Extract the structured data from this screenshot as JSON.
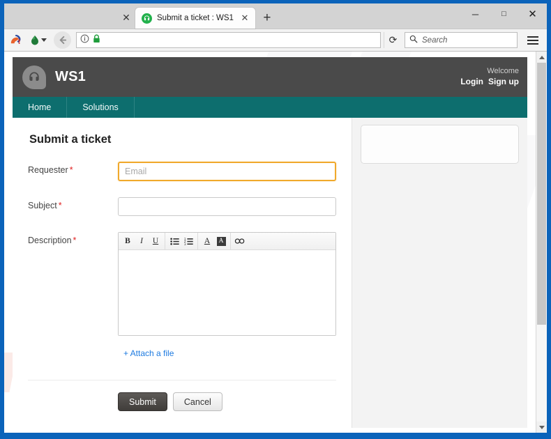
{
  "browser": {
    "window_controls": {
      "minimize": "─",
      "maximize": "□",
      "close": "✕"
    },
    "tabs": [
      {
        "title": "Submit a ticket : WS1",
        "favicon": "headset-favicon",
        "close": "✕",
        "active": true
      }
    ],
    "loose_tab_close": "✕",
    "new_tab_label": "+",
    "toolbar": {
      "icons": [
        "squirrel-logo-icon",
        "droplet-icon",
        "chevron-down-icon",
        "back-arrow-icon",
        "info-circle-icon",
        "lock-icon"
      ],
      "url_value": "",
      "url_placeholder": "",
      "reload_glyph": "⟳",
      "search_placeholder": "Search",
      "search_value": "",
      "menu_icon": "hamburger-menu-icon"
    },
    "scrollbar": {
      "up": "▲",
      "down": "▼",
      "thumb_percent": 73
    }
  },
  "site": {
    "brand": {
      "logo_icon": "headset-icon",
      "title": "WS1",
      "welcome": "Welcome",
      "links": [
        {
          "label": "Login"
        },
        {
          "label": "Sign up"
        }
      ]
    },
    "nav": [
      {
        "label": "Home"
      },
      {
        "label": "Solutions"
      }
    ],
    "watermark": "risk.com"
  },
  "form": {
    "title": "Submit a ticket",
    "fields": {
      "requester": {
        "label": "Requester",
        "required_marker": "*",
        "placeholder": "Email",
        "value": "",
        "focused": true
      },
      "subject": {
        "label": "Subject",
        "required_marker": "*",
        "placeholder": "",
        "value": "",
        "focused": false
      },
      "description": {
        "label": "Description",
        "required_marker": "*",
        "value": ""
      }
    },
    "editor_toolbar": [
      {
        "name": "bold-icon",
        "glyph": "B"
      },
      {
        "name": "italic-icon",
        "glyph": "I"
      },
      {
        "name": "underline-icon",
        "glyph": "U"
      },
      {
        "name": "bullet-list-icon",
        "glyph": "☰"
      },
      {
        "name": "numbered-list-icon",
        "glyph": "☰"
      },
      {
        "name": "text-color-icon",
        "glyph": "A"
      },
      {
        "name": "highlight-color-icon",
        "glyph": "A"
      },
      {
        "name": "insert-link-icon",
        "glyph": "∞"
      }
    ],
    "attach_label": "+ Attach a file",
    "buttons": {
      "submit": "Submit",
      "cancel": "Cancel"
    }
  },
  "colors": {
    "window_frame": "#0b63ba",
    "brand_bar": "#4a4a4a",
    "nav_bar": "#0d6e6e",
    "focus_border": "#f0a92c",
    "required": "#e02020",
    "link": "#1d7ae0",
    "favicon": "#22b14c"
  }
}
